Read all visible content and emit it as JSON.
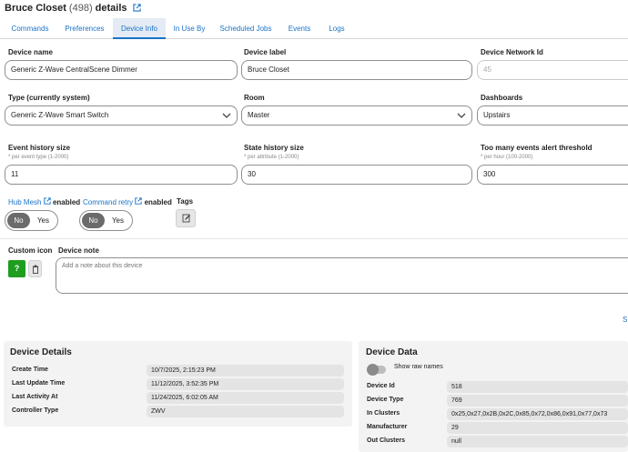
{
  "header": {
    "device_name": "Bruce Closet",
    "count": "(498)",
    "suffix": "details"
  },
  "tabs": [
    "Commands",
    "Preferences",
    "Device Info",
    "In Use By",
    "Scheduled Jobs",
    "Events",
    "Logs"
  ],
  "active_tab": "Device Info",
  "fields": {
    "device_name": {
      "label": "Device name",
      "value": "Generic Z-Wave CentralScene Dimmer"
    },
    "device_label": {
      "label": "Device label",
      "value": "Bruce Closet"
    },
    "network_id": {
      "label": "Device Network Id",
      "value": "45"
    },
    "type": {
      "label": "Type (currently system)",
      "value": "Generic Z-Wave Smart Switch"
    },
    "room": {
      "label": "Room",
      "value": "Master"
    },
    "dashboards": {
      "label": "Dashboards",
      "value": "Upstairs"
    },
    "event_history": {
      "label": "Event history size",
      "hint": "* per event type (1-2000)",
      "value": "11"
    },
    "state_history": {
      "label": "State history size",
      "hint": "* per attribute (1-2000)",
      "value": "30"
    },
    "too_many_events": {
      "label": "Too many events alert threshold",
      "hint": "* per hour (100-2000)",
      "value": "300"
    }
  },
  "toggles": {
    "hub_mesh": {
      "link": "Hub Mesh",
      "suffix": "enabled",
      "no": "No",
      "yes": "Yes"
    },
    "command_retry": {
      "link": "Command retry",
      "suffix": "enabled",
      "no": "No",
      "yes": "Yes"
    }
  },
  "tags": {
    "label": "Tags"
  },
  "custom_icon": {
    "label": "Custom icon",
    "button": "?"
  },
  "device_note": {
    "label": "Device note",
    "placeholder": "Add a note about this device"
  },
  "save_fragment": "S",
  "device_details": {
    "title": "Device Details",
    "rows": [
      {
        "label": "Create Time",
        "value": "10/7/2025, 2:15:23 PM"
      },
      {
        "label": "Last Update Time",
        "value": "11/12/2025, 3:52:35 PM"
      },
      {
        "label": "Last Activity At",
        "value": "11/24/2025, 6:02:05 AM"
      },
      {
        "label": "Controller Type",
        "value": "ZWV"
      }
    ]
  },
  "device_data": {
    "title": "Device Data",
    "show_raw": "Show raw names",
    "rows": [
      {
        "label": "Device Id",
        "value": "518"
      },
      {
        "label": "Device Type",
        "value": "769"
      },
      {
        "label": "In Clusters",
        "value": "0x25,0x27,0x2B,0x2C,0x85,0x72,0x86,0x91,0x77,0x73"
      },
      {
        "label": "Manufacturer",
        "value": "29"
      },
      {
        "label": "Out Clusters",
        "value": "null"
      }
    ]
  },
  "colors": {
    "accent": "#1a73c8",
    "toggle_active": "#6b6b6b",
    "green": "#1f9d1f"
  }
}
